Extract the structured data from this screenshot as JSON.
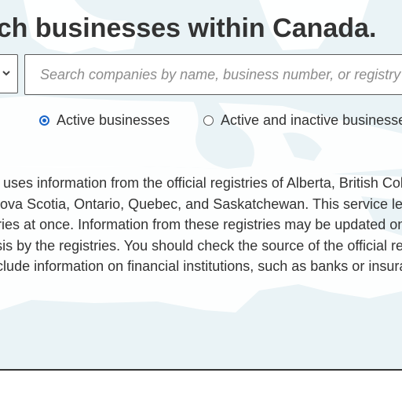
{
  "page": {
    "heading": "Search businesses within Canada.",
    "colors": {
      "accent": "#1a66c9",
      "text": "#333333",
      "map_land": "#ffffff",
      "map_water": "#eaf3f6"
    }
  },
  "search": {
    "placeholder": "Search companies by name, business number, or registry ID",
    "value": "",
    "select_icon": "chevron-down-icon"
  },
  "filters": {
    "options": [
      {
        "label": "Active businesses",
        "checked": true
      },
      {
        "label": "Active and inactive businesses",
        "checked": false
      }
    ]
  },
  "info": {
    "lines": [
      "This service uses information from the official registries of Alberta, British Columbia, Canada,",
      "Manitoba, Nova Scotia, Ontario, Quebec, and Saskatchewan. This service lets you search",
      "these registries at once. Information from these registries may be updated on a daily or more",
      "frequent basis by the registries. You should check the source of the official registry",
      "It doesn’t include information on financial institutions, such as banks or insurance companies."
    ]
  }
}
